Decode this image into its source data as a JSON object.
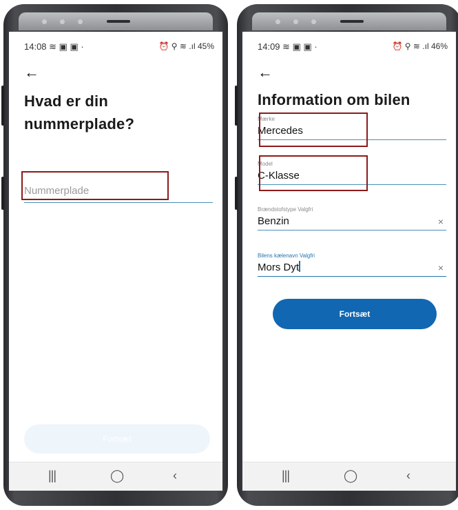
{
  "left": {
    "status": {
      "time": "14:08 ≋ ▣ ▣ ·",
      "right": "⏰ ⚲ ≋ .ıl 45%"
    },
    "back_icon": "←",
    "title": "Hvad er din nummerplade?",
    "input": {
      "placeholder": "Nummerplade"
    },
    "button": {
      "label": "Fortsæt"
    },
    "nav": {
      "recent": "|||",
      "home": "◯",
      "back": "‹"
    }
  },
  "right": {
    "status": {
      "time": "14:09 ≋ ▣ ▣ ·",
      "right": "⏰ ⚲ ≋ .ıl 46%"
    },
    "back_icon": "←",
    "title": "Information om bilen",
    "fields": [
      {
        "label": "Mærke",
        "value": "Mercedes"
      },
      {
        "label": "Model",
        "value": "C-Klasse"
      },
      {
        "label": "Brændstofstype Valgfri",
        "value": "Benzin",
        "clear": "×"
      },
      {
        "label": "Bilens kælenavn Valgfri",
        "value": "Mors Dyt",
        "clear": "×"
      }
    ],
    "button": {
      "label": "Fortsæt"
    },
    "nav": {
      "recent": "|||",
      "home": "◯",
      "back": "‹"
    }
  },
  "colors": {
    "accent": "#1167b1",
    "highlight": "#8b1a1a",
    "underline": "#4a90b8"
  },
  "icons": [
    "back-arrow-icon",
    "clear-icon",
    "alarm-icon",
    "location-icon",
    "wifi-icon",
    "signal-icon",
    "battery-icon"
  ]
}
